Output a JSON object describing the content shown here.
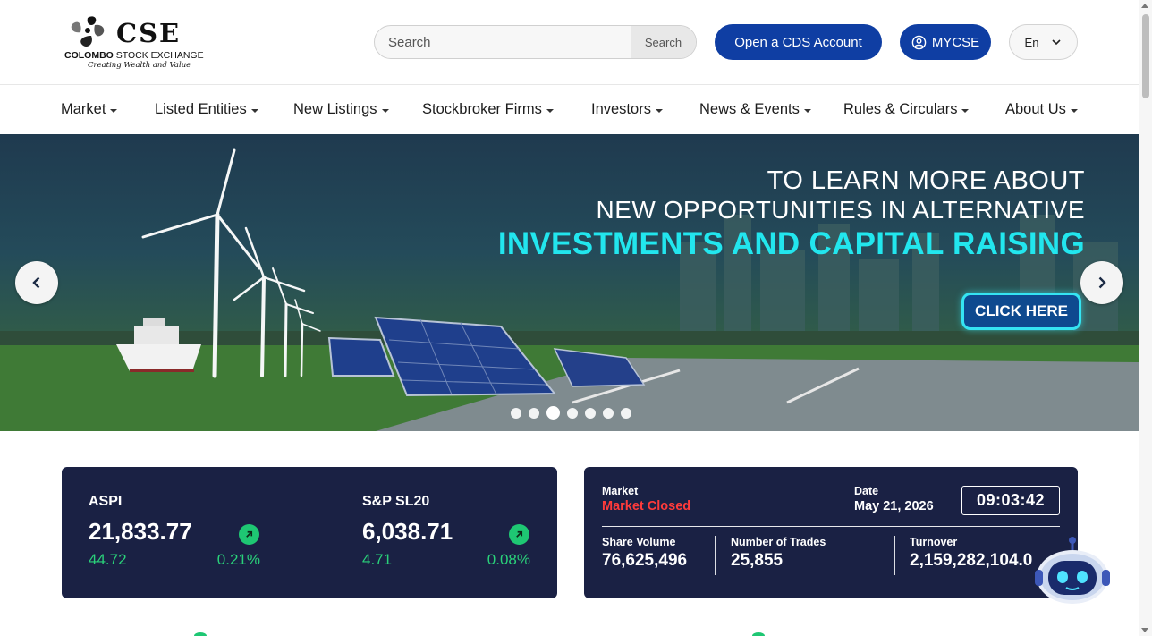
{
  "logo": {
    "wordmark": "CSE",
    "name_bold": "COLOMBO",
    "name_rest": "STOCK EXCHANGE",
    "tagline": "Creating Wealth and Value"
  },
  "header": {
    "search_placeholder": "Search",
    "search_button": "Search",
    "cds_button": "Open a CDS Account",
    "mycse_button": "MYCSE",
    "language": "En"
  },
  "nav": {
    "items": [
      {
        "label": "Market"
      },
      {
        "label": "Listed Entities"
      },
      {
        "label": "New Listings"
      },
      {
        "label": "Stockbroker Firms"
      },
      {
        "label": "Investors"
      },
      {
        "label": "News & Events"
      },
      {
        "label": "Rules & Circulars"
      },
      {
        "label": "About Us"
      }
    ]
  },
  "banner": {
    "line1": "TO LEARN MORE ABOUT",
    "line2": "NEW OPPORTUNITIES IN ALTERNATIVE",
    "line3": "INVESTMENTS AND CAPITAL RAISING",
    "cta": "CLICK HERE",
    "slide_count": 7,
    "active_slide": 3
  },
  "indices": [
    {
      "name": "ASPI",
      "value": "21,833.77",
      "change": "44.72",
      "percent": "0.21%"
    },
    {
      "name": "S&P SL20",
      "value": "6,038.71",
      "change": "4.71",
      "percent": "0.08%"
    }
  ],
  "market": {
    "status_label": "Market",
    "status": "Market Closed",
    "date_label": "Date",
    "date": "May 21, 2026",
    "time": "09:03:42",
    "share_volume_label": "Share Volume",
    "share_volume": "76,625,496",
    "trades_label": "Number of Trades",
    "trades": "25,855",
    "turnover_label": "Turnover",
    "turnover": "2,159,282,104.0"
  },
  "colors": {
    "primary_blue": "#0f3ea3",
    "card_navy": "#1a2144",
    "positive_green": "#2ad17a",
    "closed_red": "#ff3b3b",
    "banner_cyan": "#22e6ee"
  }
}
